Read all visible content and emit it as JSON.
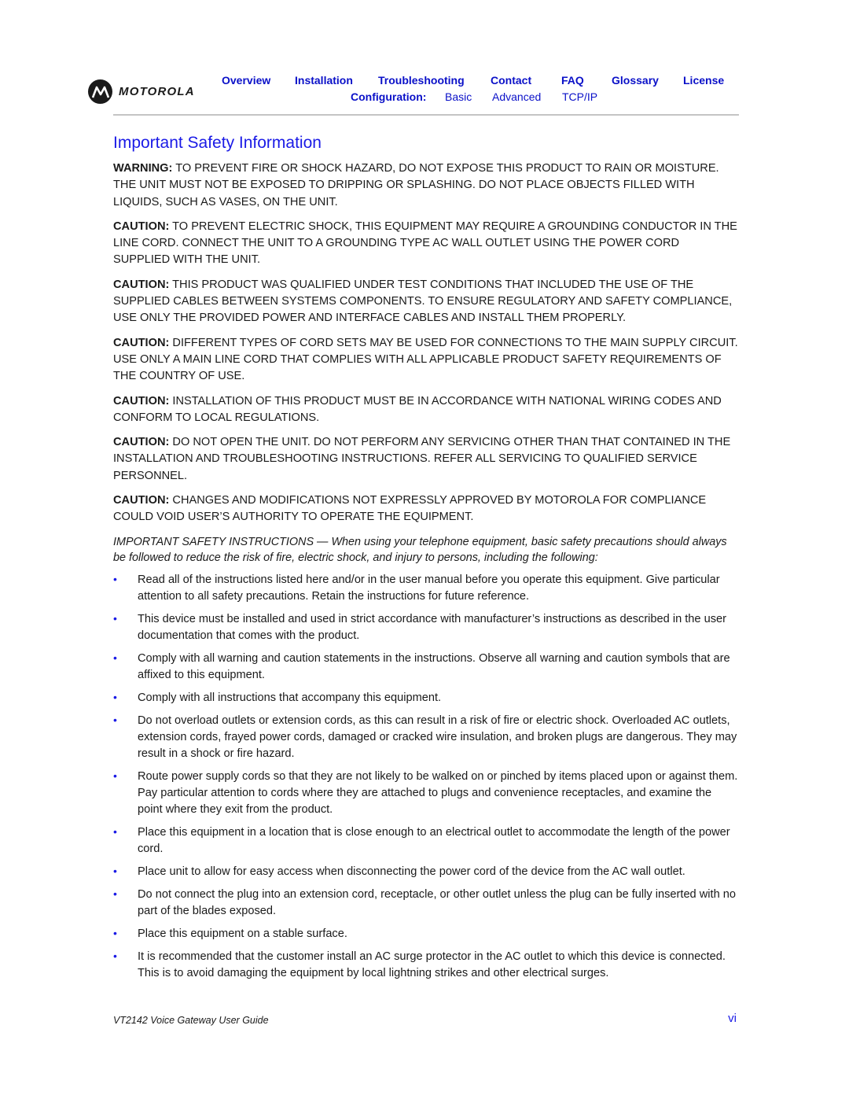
{
  "header": {
    "brand": "MOTOROLA",
    "nav": [
      "Overview",
      "Installation",
      "Troubleshooting",
      "Contact",
      "FAQ",
      "Glossary",
      "License"
    ],
    "config_label": "Configuration:",
    "config_links": [
      "Basic",
      "Advanced",
      "TCP/IP"
    ]
  },
  "colors": {
    "link": "#0a10c8",
    "title": "#1a1ae6",
    "rule": "#c4c4c4"
  },
  "title": "Important Safety Information",
  "paragraphs": [
    {
      "label": "WARNING:",
      "text": " TO PREVENT FIRE OR SHOCK HAZARD, DO NOT EXPOSE THIS PRODUCT TO RAIN OR MOISTURE. THE UNIT MUST NOT BE EXPOSED TO DRIPPING OR SPLASHING. DO NOT PLACE OBJECTS FILLED WITH LIQUIDS, SUCH AS VASES, ON THE UNIT."
    },
    {
      "label": "CAUTION:",
      "text": " TO PREVENT ELECTRIC SHOCK, THIS EQUIPMENT MAY REQUIRE A GROUNDING CONDUCTOR IN THE LINE CORD. CONNECT THE UNIT TO A GROUNDING TYPE AC WALL OUTLET USING THE POWER CORD SUPPLIED WITH THE UNIT."
    },
    {
      "label": "CAUTION:",
      "text": " THIS PRODUCT WAS QUALIFIED UNDER TEST CONDITIONS THAT INCLUDED THE USE OF THE SUPPLIED CABLES BETWEEN SYSTEMS COMPONENTS. TO ENSURE REGULATORY AND SAFETY COMPLIANCE, USE ONLY THE PROVIDED POWER AND INTERFACE CABLES AND INSTALL THEM PROPERLY."
    },
    {
      "label": "CAUTION:",
      "text": " DIFFERENT TYPES OF CORD SETS MAY BE USED FOR CONNECTIONS TO THE MAIN SUPPLY CIRCUIT. USE ONLY A MAIN LINE CORD THAT COMPLIES WITH ALL APPLICABLE PRODUCT SAFETY REQUIREMENTS OF THE COUNTRY OF USE."
    },
    {
      "label": "CAUTION:",
      "text": " INSTALLATION OF THIS PRODUCT MUST BE IN ACCORDANCE WITH NATIONAL WIRING CODES AND CONFORM TO LOCAL REGULATIONS."
    },
    {
      "label": "CAUTION:",
      "text": " DO NOT OPEN THE UNIT. DO NOT PERFORM ANY SERVICING OTHER THAN THAT CONTAINED IN THE INSTALLATION AND TROUBLESHOOTING INSTRUCTIONS. REFER ALL SERVICING TO QUALIFIED SERVICE PERSONNEL."
    },
    {
      "label": "CAUTION:",
      "text": " CHANGES AND MODIFICATIONS NOT EXPRESSLY APPROVED BY MOTOROLA FOR COMPLIANCE COULD VOID USER’S AUTHORITY TO OPERATE THE EQUIPMENT."
    }
  ],
  "instructions_intro": "IMPORTANT SAFETY INSTRUCTIONS — When using your telephone equipment, basic safety precautions should always be followed to reduce the risk of fire, electric shock, and injury to persons, including the following:",
  "bullet_glyph": "•",
  "bullets": [
    "Read all of the instructions listed here and/or in the user manual before you operate this equipment. Give particular attention to all safety precautions. Retain the instructions for future reference.",
    "This device must be installed and used in strict accordance with manufacturer’s instructions as described in the user documentation that comes with the product.",
    "Comply with all warning and caution statements in the instructions. Observe all warning and caution symbols that are affixed to this equipment.",
    "Comply with all instructions that accompany this equipment.",
    "Do not overload outlets or extension cords, as this can result in a risk of fire or electric shock. Overloaded AC outlets, extension cords, frayed power cords, damaged or cracked wire insulation, and broken plugs are dangerous. They may result in a shock or fire hazard.",
    "Route power supply cords so that they are not likely to be walked on or pinched by items placed upon or against them. Pay particular attention to cords where they are attached to plugs and convenience receptacles, and examine the point where they exit from the product.",
    "Place this equipment in a location that is close enough to an electrical outlet to accommodate the length of the power cord.",
    "Place unit to allow for easy access when disconnecting the power cord of the device from the AC wall outlet.",
    "Do not connect the plug into an extension cord, receptacle, or other outlet unless the plug can be fully inserted with no part of the blades exposed.",
    "Place this equipment on a stable surface.",
    "It is recommended that the customer install an AC surge protector in the AC outlet to which this device is connected. This is to avoid damaging the equipment by local lightning strikes and other electrical surges."
  ],
  "footer": {
    "title": "VT2142 Voice Gateway User Guide",
    "page": "vi"
  }
}
